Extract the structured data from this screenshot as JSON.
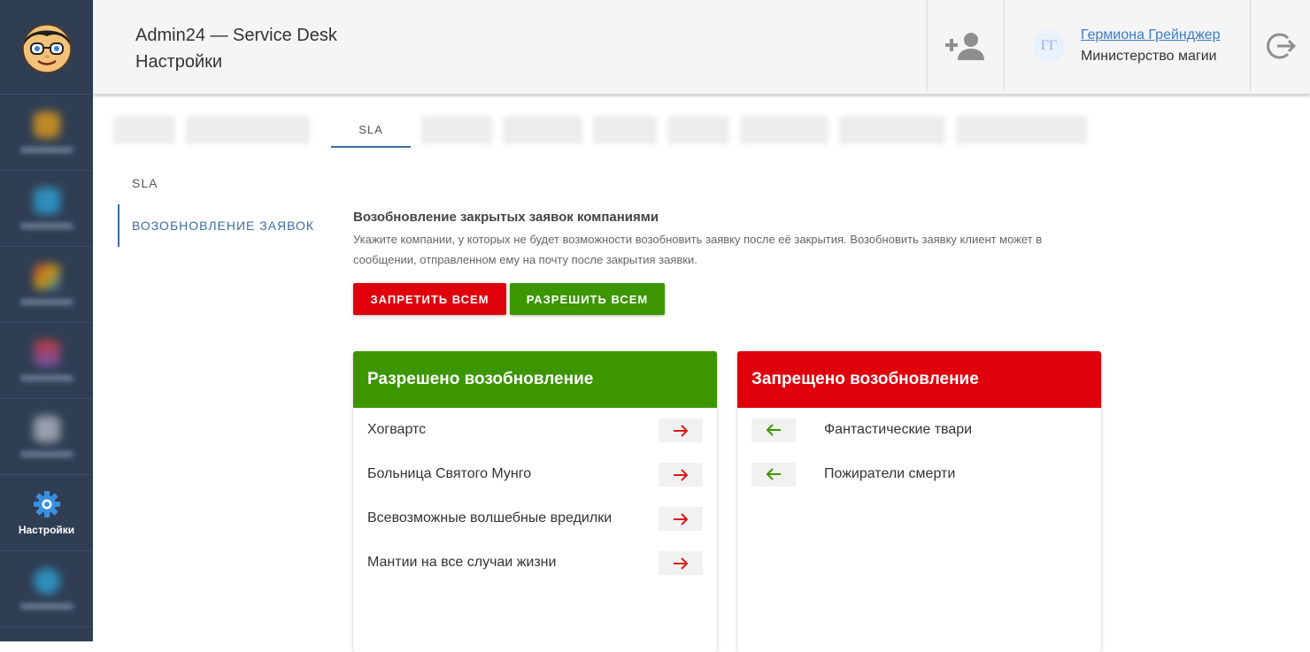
{
  "header": {
    "app_title": "Admin24 — Service Desk",
    "page_title": "Настройки",
    "user": {
      "initials": "ГГ",
      "name": "Гермиона Грейнджер",
      "organization": "Министерство магии"
    }
  },
  "nav": {
    "active_label": "Настройки"
  },
  "tabs": {
    "active_label": "SLA"
  },
  "subnav": {
    "items": [
      "SLA",
      "ВОЗОБНОВЛЕНИЕ ЗАЯВОК"
    ]
  },
  "content": {
    "title": "Возобновление закрытых заявок компаниями",
    "description": "Укажите компании, у которых не будет возможности возобновить заявку после её закрытия. Возобновить заявку клиент может в сообщении, отправленном ему на почту после закрытия заявки.",
    "deny_all_label": "ЗАПРЕТИТЬ ВСЕМ",
    "allow_all_label": "РАЗРЕШИТЬ ВСЕМ"
  },
  "allowed_panel": {
    "title": "Разрешено возобновление",
    "items": [
      "Хогвартс",
      "Больница Святого Мунго",
      "Всевозможные волшебные вредилки",
      "Мантии на все случаи жизни"
    ]
  },
  "denied_panel": {
    "title": "Запрещено возобновление",
    "items": [
      "Фантастические твари",
      "Пожиратели смерти"
    ]
  },
  "colors": {
    "nav_bg": "#2f3e53",
    "green": "#3b9600",
    "red": "#e0000c",
    "accent_blue": "#3a6ea0",
    "link_blue": "#3a7bc8"
  }
}
